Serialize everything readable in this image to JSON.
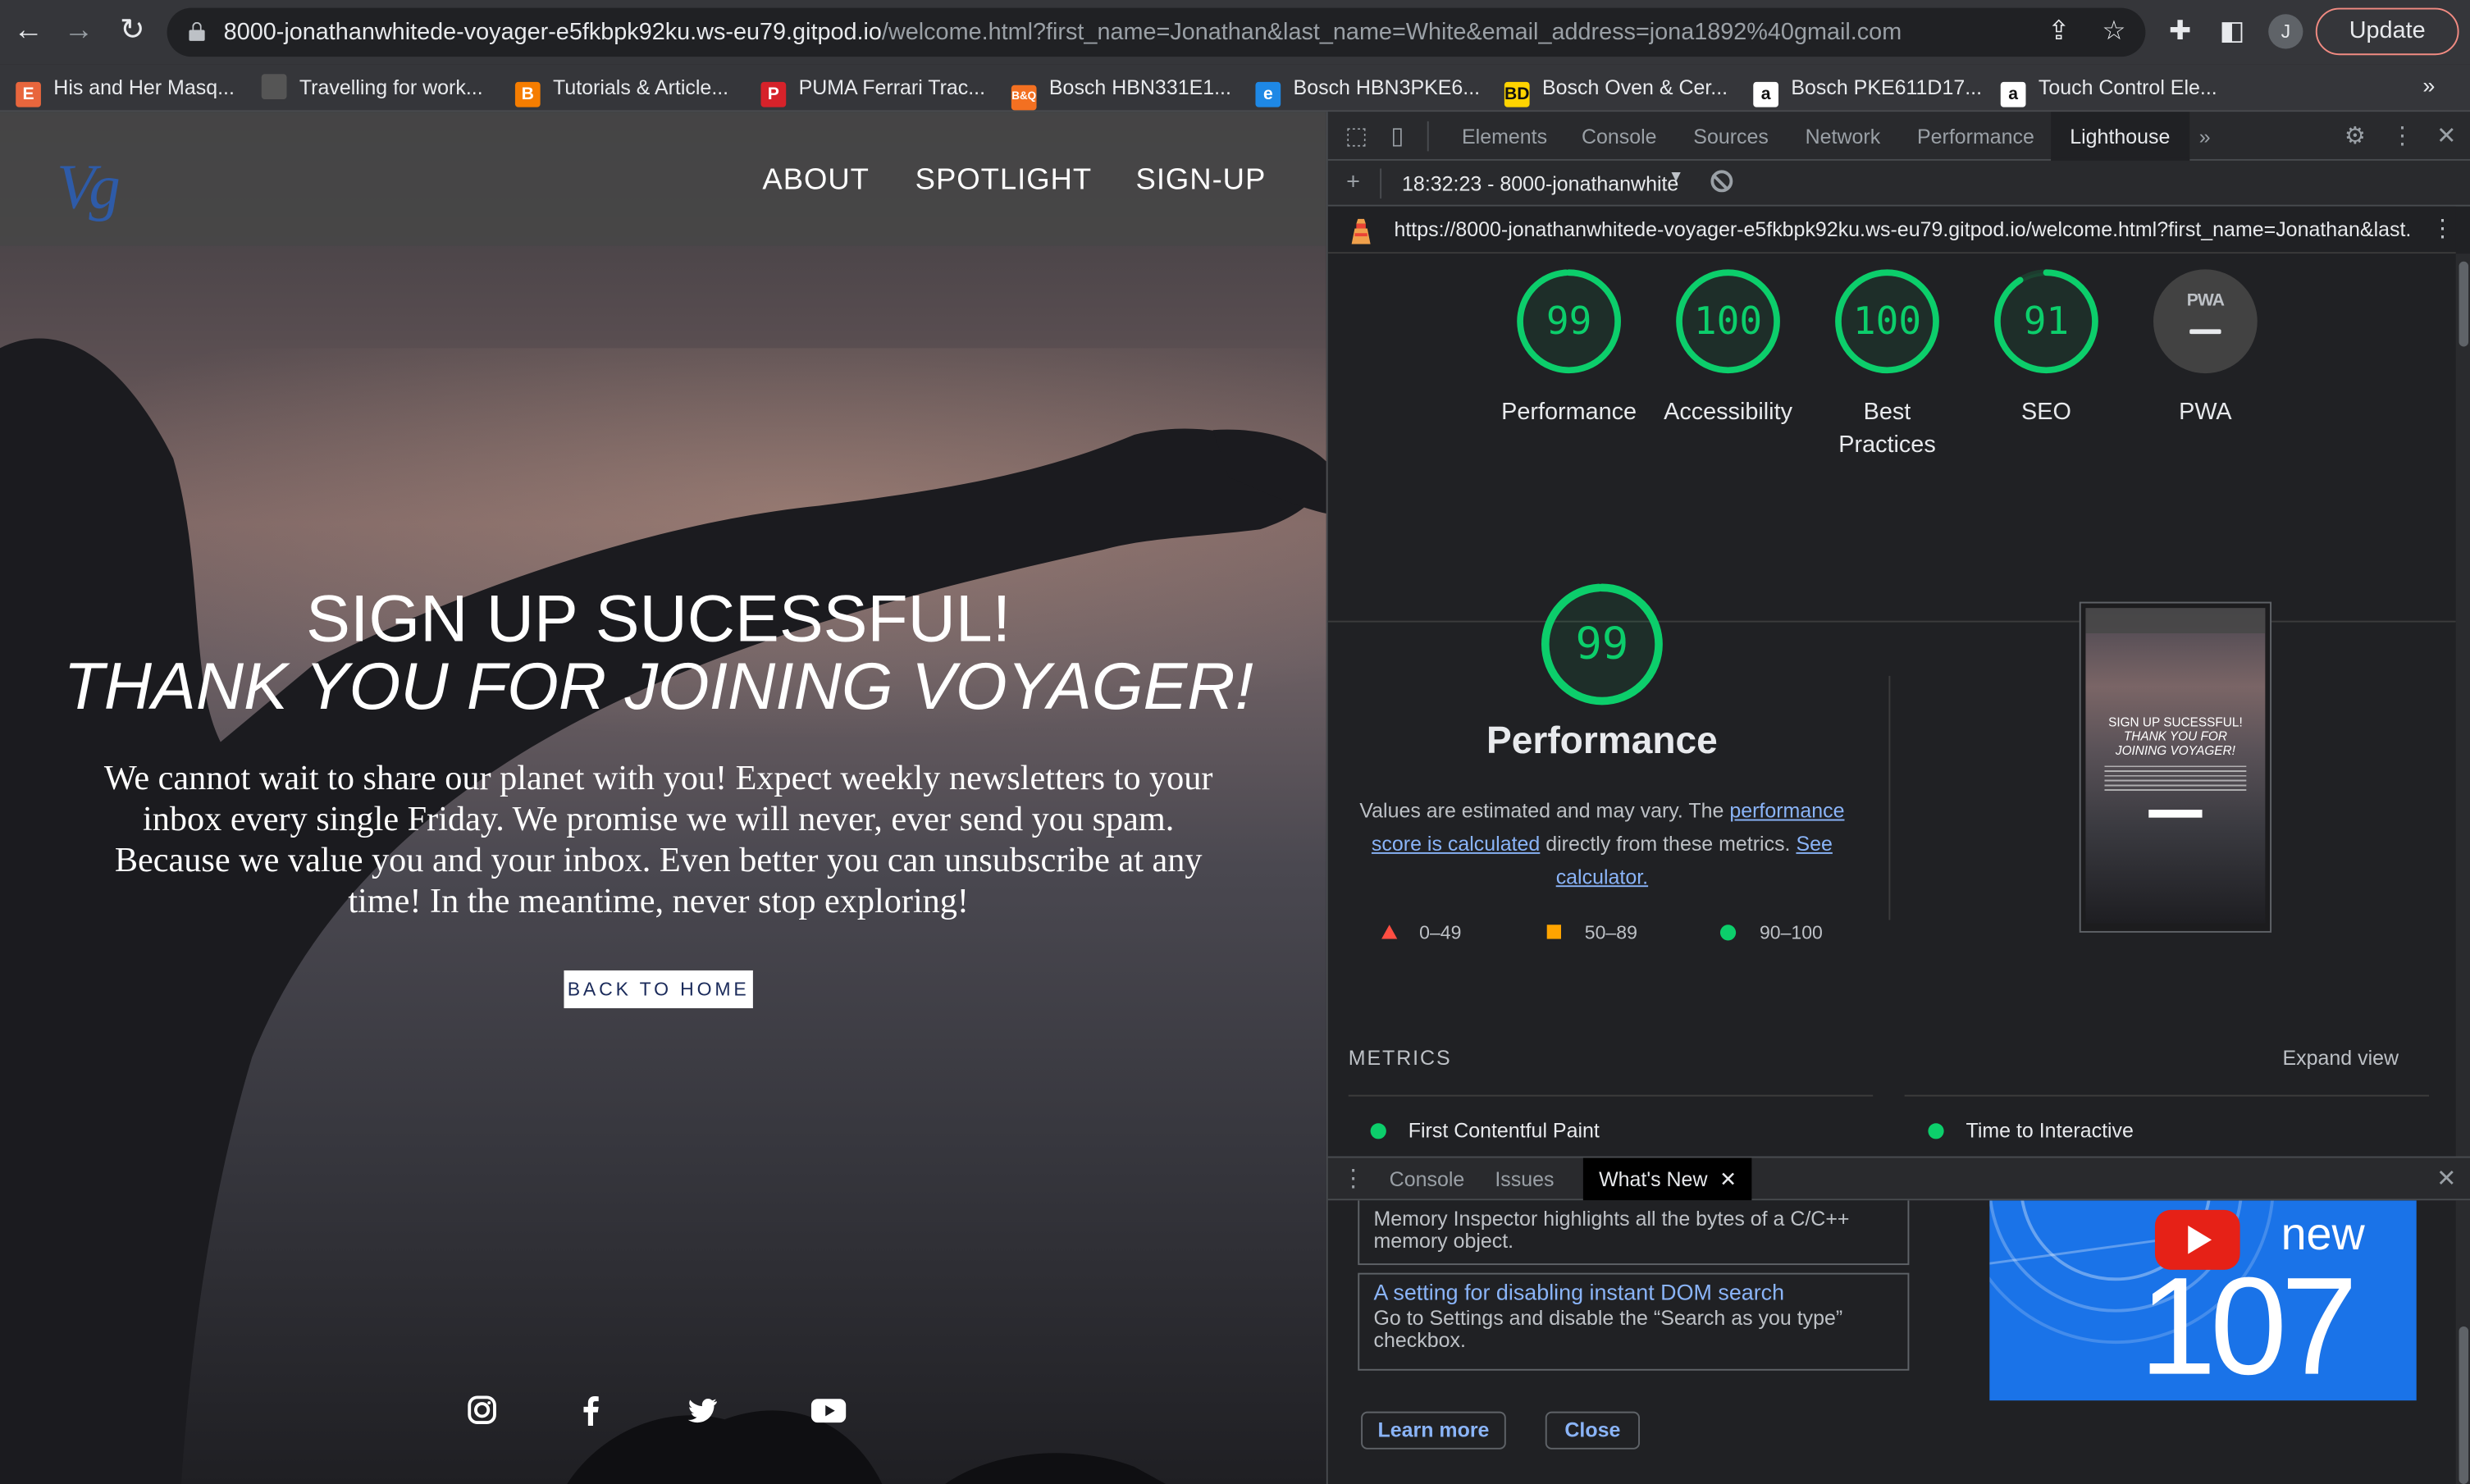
{
  "browser": {
    "url_host": "8000-jonathanwhitede-voyager-e5fkbpk92ku.ws-eu79.gitpod.io",
    "url_rest": "/welcome.html?first_name=Jonathan&last_name=White&email_address=jona1892%40gmail.com",
    "profile_initial": "J",
    "update_label": "Update",
    "bookmarks": [
      {
        "label": "His and Her Masq...",
        "fav": "E",
        "color": "#e8663d"
      },
      {
        "label": "Travelling for work...",
        "fav": "",
        "color": "#555555"
      },
      {
        "label": "Tutorials & Article...",
        "fav": "B",
        "color": "#f57d00"
      },
      {
        "label": "PUMA Ferrari Trac...",
        "fav": "P",
        "color": "#d6222a"
      },
      {
        "label": "Bosch HBN331E1...",
        "fav": "B&Q",
        "color": "#f37021"
      },
      {
        "label": "Bosch HBN3PKE6...",
        "fav": "e",
        "color": "#1e88e5"
      },
      {
        "label": "Bosch Oven & Cer...",
        "fav": "BD",
        "color": "#ffd400"
      },
      {
        "label": "Bosch PKE611D17...",
        "fav": "a",
        "color": "#ffffff"
      },
      {
        "label": "Touch Control Ele...",
        "fav": "a",
        "color": "#ffffff"
      }
    ],
    "bookmarks_more": "»"
  },
  "site": {
    "logo": "Vg",
    "nav": [
      "ABOUT",
      "SPOTLIGHT",
      "SIGN-UP"
    ],
    "heading_line1": "SIGN UP SUCESSFUL!",
    "heading_line2": "THANK YOU FOR JOINING VOYAGER!",
    "body": "We cannot wait to share our planet with you! Expect weekly newsletters to your inbox every single Friday. We promise we will never, ever send you spam. Because we value you and your inbox. Even better you can unsubscribe at any time! In the meantime, never stop exploring!",
    "button": "BACK TO HOME",
    "social_icons": [
      "instagram-icon",
      "facebook-icon",
      "twitter-icon",
      "youtube-icon"
    ]
  },
  "devtools": {
    "tabs": [
      "Elements",
      "Console",
      "Sources",
      "Network",
      "Performance",
      "Lighthouse"
    ],
    "active_tab": "Lighthouse",
    "more_tabs": "»",
    "report_selector": "18:32:23 - 8000-jonathanwhit⁠e",
    "report_url": "https://8000-jonathanwhitede-voyager-e5fkbpk92ku.ws-eu79.gitpod.io/welcome.html?first_name=Jonathan&last...",
    "scores": [
      {
        "label": "Performance",
        "value": 99,
        "fraction": 0.99
      },
      {
        "label": "Accessibility",
        "value": 100,
        "fraction": 1.0
      },
      {
        "label": "Best Practices",
        "value": 100,
        "fraction": 1.0
      },
      {
        "label": "SEO",
        "value": 91,
        "fraction": 0.91
      }
    ],
    "pwa_label": "PWA",
    "pwa_badge": "PWA",
    "perf_big_score": 99,
    "perf_title": "Performance",
    "perf_desc_1": "Values are estimated and may vary. The ",
    "perf_desc_link1": "performance score is calculated",
    "perf_desc_2": " directly from these metrics. ",
    "perf_desc_link2": "See calculator.",
    "legend": [
      "0–49",
      "50–89",
      "90–100"
    ],
    "metrics_heading": "METRICS",
    "expand_view": "Expand view",
    "metrics": [
      "First Contentful Paint",
      "Time to Interactive"
    ],
    "thumb": {
      "line1": "SIGN UP SUCESSFUL!",
      "line2": "THANK YOU FOR",
      "line3": "JOINING VOYAGER!"
    },
    "colors": {
      "pass": "#0cce6b",
      "average": "#ffa400",
      "fail": "#ff4e42"
    }
  },
  "drawer": {
    "tabs": [
      "Console",
      "Issues",
      "What's New"
    ],
    "active_tab": "What's New",
    "card1_text": "Memory Inspector highlights all the bytes of a C/C++ memory object.",
    "card2_title": "A setting for disabling instant DOM search",
    "card2_text": "Go to Settings and disable the “Search as you type” checkbox.",
    "learn_more": "Learn more",
    "close": "Close",
    "promo_new": "new",
    "promo_version": "107"
  }
}
